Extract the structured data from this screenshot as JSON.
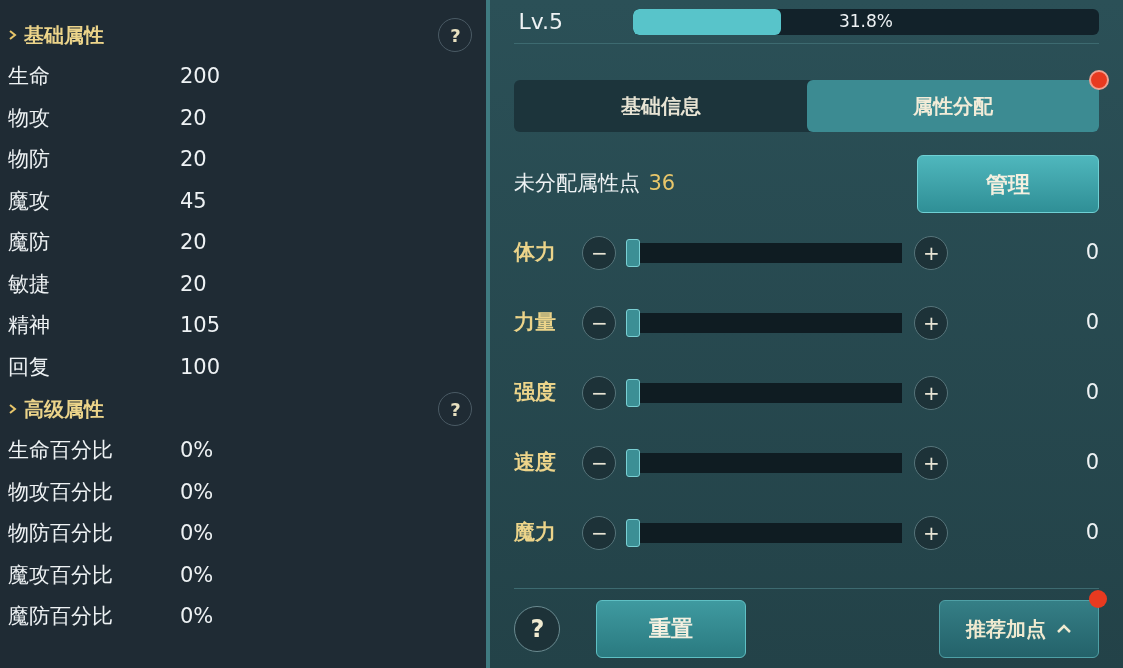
{
  "basic_section": {
    "title": "基础属性",
    "help": "?",
    "stats": [
      {
        "label": "生命",
        "value": "200"
      },
      {
        "label": "物攻",
        "value": "20"
      },
      {
        "label": "物防",
        "value": "20"
      },
      {
        "label": "魔攻",
        "value": "45"
      },
      {
        "label": "魔防",
        "value": "20"
      },
      {
        "label": "敏捷",
        "value": "20"
      },
      {
        "label": "精神",
        "value": "105"
      },
      {
        "label": "回复",
        "value": "100"
      }
    ]
  },
  "advanced_section": {
    "title": "高级属性",
    "help": "?",
    "stats": [
      {
        "label": "生命百分比",
        "value": "0%"
      },
      {
        "label": "物攻百分比",
        "value": "0%"
      },
      {
        "label": "物防百分比",
        "value": "0%"
      },
      {
        "label": "魔攻百分比",
        "value": "0%"
      },
      {
        "label": "魔防百分比",
        "value": "0%"
      }
    ]
  },
  "level": {
    "label": "Lv.5",
    "level": 0.318,
    "reading": "31.8%"
  },
  "tabs": [
    {
      "label": "基础信息",
      "selected": false,
      "badge": false
    },
    {
      "label": "属性分配",
      "selected": true,
      "badge": true
    }
  ],
  "unallocated": {
    "label": "未分配属性点",
    "value": "36",
    "button": "管理"
  },
  "attributes": [
    {
      "label": "体力",
      "minus": "−",
      "plus": "+",
      "level": 0,
      "value": "0"
    },
    {
      "label": "力量",
      "minus": "−",
      "plus": "+",
      "level": 0,
      "value": "0"
    },
    {
      "label": "强度",
      "minus": "−",
      "plus": "+",
      "level": 0,
      "value": "0"
    },
    {
      "label": "速度",
      "minus": "−",
      "plus": "+",
      "level": 0,
      "value": "0"
    },
    {
      "label": "魔力",
      "minus": "−",
      "plus": "+",
      "level": 0,
      "value": "0"
    }
  ],
  "footer": {
    "help": "?",
    "reset": "重置",
    "recommend": "推荐加点",
    "recommend_badge": true
  }
}
